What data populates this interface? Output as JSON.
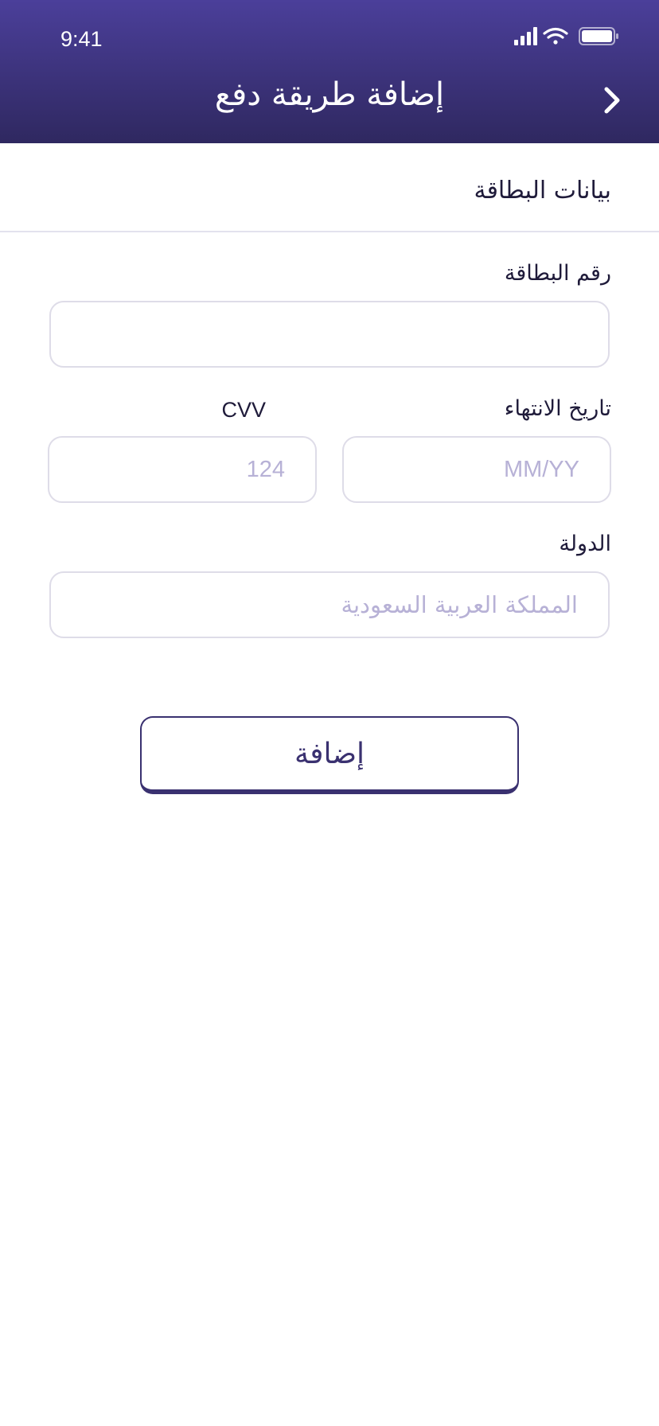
{
  "status_bar": {
    "time": "9:41",
    "icons": [
      "signal-icon",
      "wifi-icon",
      "battery-icon"
    ]
  },
  "header": {
    "title": "إضافة طريقة دفع",
    "back_icon": "chevron-right-icon"
  },
  "section": {
    "title": "بيانات البطاقة"
  },
  "form": {
    "card_number": {
      "label": "رقم البطاقة",
      "value": "",
      "placeholder": ""
    },
    "expiry": {
      "label": "تاريخ الانتهاء",
      "value": "",
      "placeholder": "MM/YY"
    },
    "cvv": {
      "label": "CVV",
      "value": "",
      "placeholder": "124"
    },
    "country": {
      "label": "الدولة",
      "value": "",
      "placeholder": "المملكة العربية السعودية"
    }
  },
  "actions": {
    "add_label": "إضافة"
  },
  "colors": {
    "header_top": "#4b3f9a",
    "header_bottom": "#2f2860",
    "accent": "#3a3170",
    "placeholder": "#b7b1d6",
    "input_border": "#dedce8"
  }
}
